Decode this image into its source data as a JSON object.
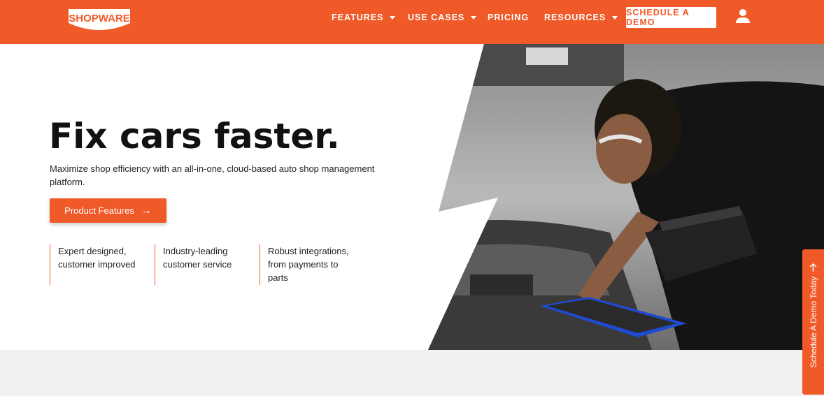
{
  "header": {
    "logo_text": "SHOPWARE",
    "nav": [
      {
        "label": "FEATURES",
        "has_dropdown": true
      },
      {
        "label": "USE CASES",
        "has_dropdown": true
      },
      {
        "label": "PRICING",
        "has_dropdown": false
      },
      {
        "label": "RESOURCES",
        "has_dropdown": true
      }
    ],
    "demo_button": "SCHEDULE A DEMO",
    "user_icon": "user-icon"
  },
  "hero": {
    "title": "Fix cars faster.",
    "subtitle": "Maximize shop efficiency with an all-in-one, cloud-based auto shop management platform.",
    "cta_label": "Product Features",
    "features": [
      "Expert designed, customer improved",
      "Industry-leading customer service",
      "Robust integrations, from payments to parts"
    ]
  },
  "side_tab": {
    "label": "Schedule A Demo Today"
  },
  "colors": {
    "brand": "#f05a28",
    "text": "#111111",
    "band": "#f1f1f1"
  }
}
